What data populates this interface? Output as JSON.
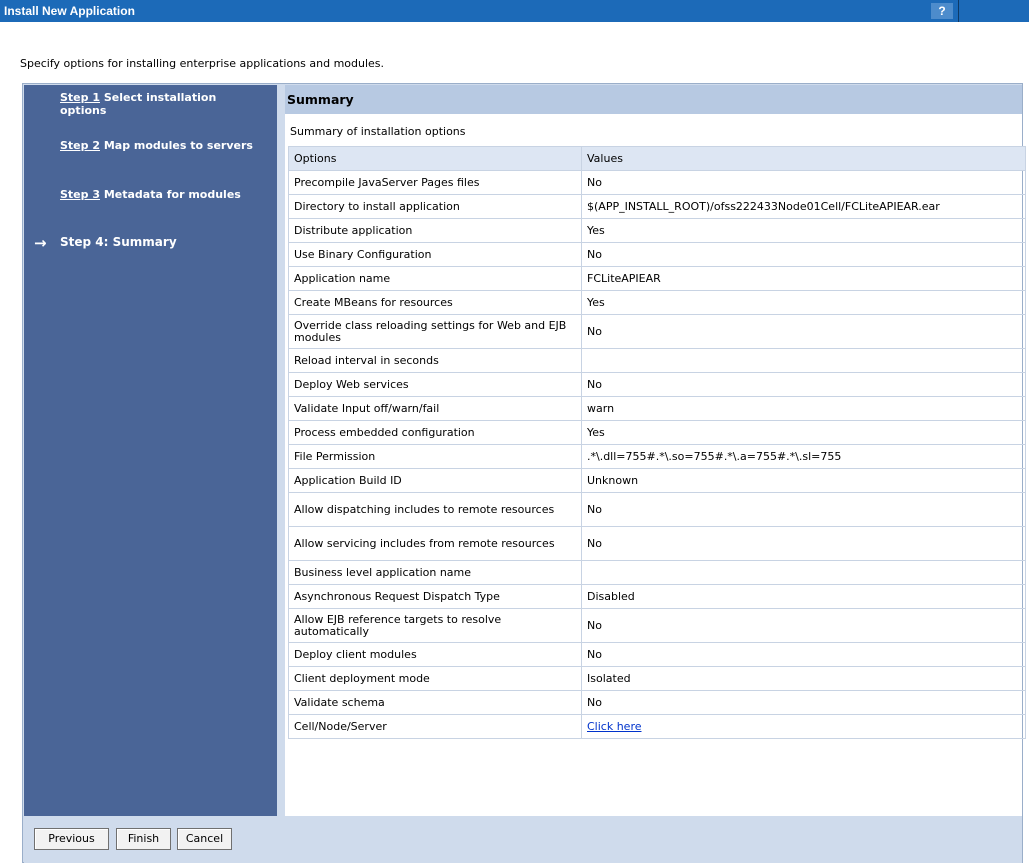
{
  "window": {
    "title": "Install New Application",
    "help_label": "?"
  },
  "intro_text": "Specify options for installing enterprise applications and modules.",
  "sidebar": {
    "steps": [
      {
        "number_label": "Step 1",
        "text": "Select installation options"
      },
      {
        "number_label": "Step 2",
        "text": "Map modules to servers"
      },
      {
        "number_label": "Step 3",
        "text": "Metadata for modules"
      },
      {
        "label": "Step 4: Summary",
        "current": true
      }
    ],
    "arrow": "→"
  },
  "main": {
    "header": "Summary",
    "caption": "Summary of installation options",
    "columns": [
      "Options",
      "Values"
    ],
    "rows": [
      {
        "option": "Precompile JavaServer Pages files",
        "value": "No"
      },
      {
        "option": "Directory to install application",
        "value": "$(APP_INSTALL_ROOT)/ofss222433Node01Cell/FCLiteAPIEAR.ear"
      },
      {
        "option": "Distribute application",
        "value": "Yes"
      },
      {
        "option": "Use Binary Configuration",
        "value": "No"
      },
      {
        "option": "Application name",
        "value": "FCLiteAPIEAR"
      },
      {
        "option": "Create MBeans for resources",
        "value": "Yes"
      },
      {
        "option": "Override class reloading settings for Web and EJB modules",
        "value": "No"
      },
      {
        "option": "Reload interval in seconds",
        "value": ""
      },
      {
        "option": "Deploy Web services",
        "value": "No"
      },
      {
        "option": "Validate Input off/warn/fail",
        "value": "warn"
      },
      {
        "option": "Process embedded configuration",
        "value": "Yes"
      },
      {
        "option": "File Permission",
        "value": ".*\\.dll=755#.*\\.so=755#.*\\.a=755#.*\\.sl=755"
      },
      {
        "option": "Application Build ID",
        "value": "Unknown"
      },
      {
        "option": "Allow dispatching includes to remote resources",
        "value": "No"
      },
      {
        "option": "Allow servicing includes from remote resources",
        "value": "No"
      },
      {
        "option": "Business level application name",
        "value": ""
      },
      {
        "option": "Asynchronous Request Dispatch Type",
        "value": "Disabled"
      },
      {
        "option": "Allow EJB reference targets to resolve automatically",
        "value": "No"
      },
      {
        "option": "Deploy client modules",
        "value": "No"
      },
      {
        "option": "Client deployment mode",
        "value": "Isolated"
      },
      {
        "option": "Validate schema",
        "value": "No"
      },
      {
        "option": "Cell/Node/Server",
        "value": "Click here"
      }
    ]
  },
  "buttons": {
    "previous": "Previous",
    "finish": "Finish",
    "cancel": "Cancel"
  }
}
